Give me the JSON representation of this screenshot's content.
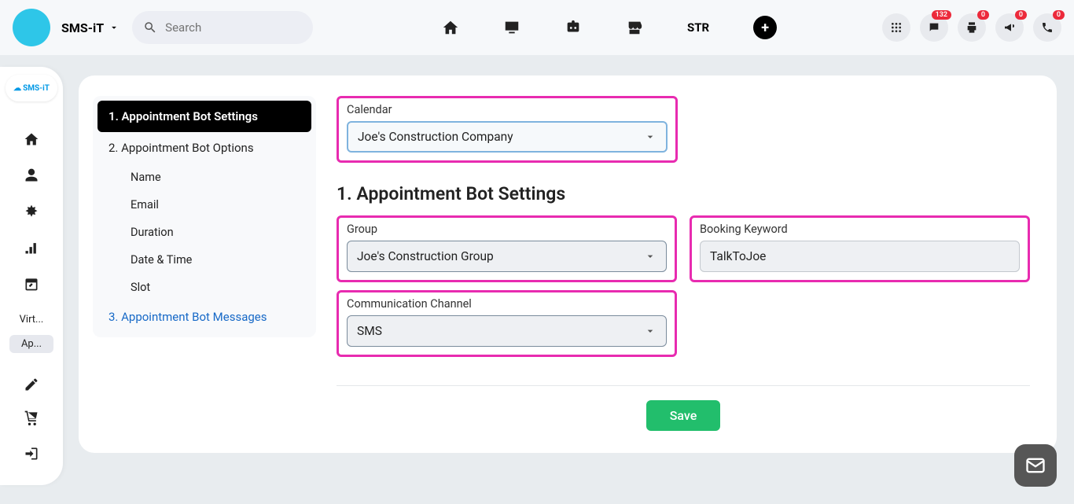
{
  "header": {
    "brand": "SMS-iT",
    "search_placeholder": "Search",
    "str_label": "STR",
    "badges": {
      "chat": "132",
      "print": "0",
      "bullhorn": "0",
      "phone": "0"
    }
  },
  "sidebar": {
    "logo_text": "SMS-iT",
    "labels": {
      "virt": "Virt...",
      "app": "Ap..."
    }
  },
  "nav": {
    "item1": "1. Appointment Bot Settings",
    "item2": "2. Appointment Bot Options",
    "sub_name": "Name",
    "sub_email": "Email",
    "sub_duration": "Duration",
    "sub_datetime": "Date & Time",
    "sub_slot": "Slot",
    "item3": "3. Appointment Bot Messages"
  },
  "form": {
    "calendar_label": "Calendar",
    "calendar_value": "Joe's Construction Company",
    "section_title": "1. Appointment Bot Settings",
    "group_label": "Group",
    "group_value": "Joe's Construction Group",
    "keyword_label": "Booking Keyword",
    "keyword_value": "TalkToJoe",
    "channel_label": "Communication Channel",
    "channel_value": "SMS",
    "save": "Save"
  }
}
